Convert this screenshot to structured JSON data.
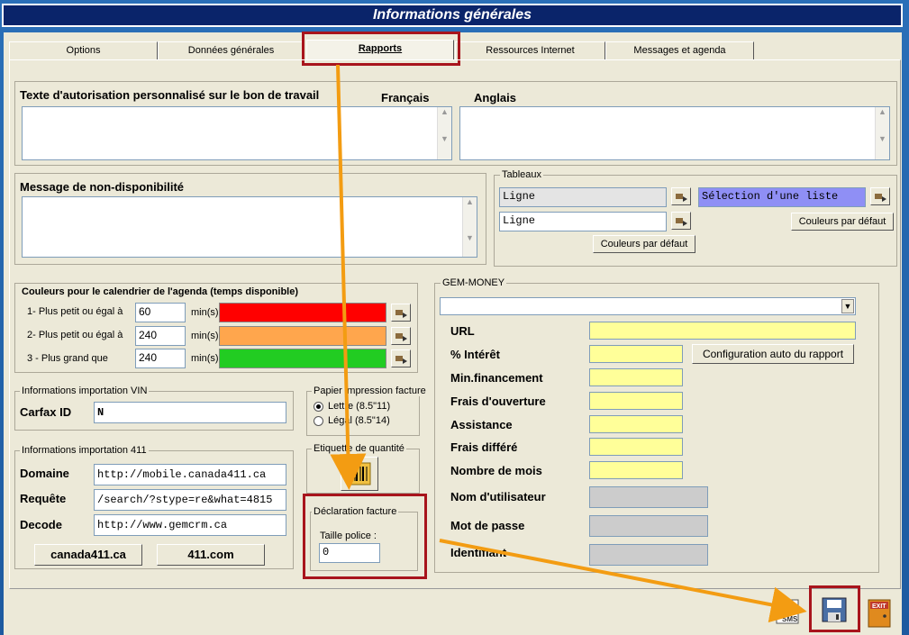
{
  "window": {
    "title": "Informations générales"
  },
  "tabs": [
    {
      "label": "Options"
    },
    {
      "label": "Données générales"
    },
    {
      "label": "Rapports"
    },
    {
      "label": "Ressources Internet"
    },
    {
      "label": "Messages et agenda"
    }
  ],
  "auth_text": {
    "title": "Texte d'autorisation personnalisé sur le bon de travail",
    "french_label": "Français",
    "english_label": "Anglais",
    "french_value": "",
    "english_value": ""
  },
  "unavailable": {
    "title": "Message de non-disponibilité",
    "value": ""
  },
  "tableaux": {
    "title": "Tableaux",
    "field1": "Ligne",
    "field2": "Ligne",
    "list_select": "Sélection d'une liste",
    "default_colors_1": "Couleurs par défaut",
    "default_colors_2": "Couleurs par défaut"
  },
  "calendar_colors": {
    "title": "Couleurs pour le calendrier de l'agenda (temps disponible)",
    "unit": "min(s)",
    "rows": [
      {
        "label": "1- Plus petit ou égal à",
        "value": "60",
        "color": "#ff0000"
      },
      {
        "label": "2- Plus petit ou égal à",
        "value": "240",
        "color": "#ffa64d"
      },
      {
        "label": "3 - Plus grand que",
        "value": "240",
        "color": "#22cc22"
      }
    ]
  },
  "vin": {
    "title": "Informations importation VIN",
    "label": "Carfax ID",
    "value": "N"
  },
  "paper": {
    "title": "Papier impression facture",
    "opt1": "Lettre (8.5\"11)",
    "opt2": "Légal (8.5\"14)"
  },
  "import411": {
    "title": "Informations importation 411",
    "domaine_label": "Domaine",
    "domaine_value": "http://mobile.canada411.ca",
    "requete_label": "Requête",
    "requete_value": "/search/?stype=re&what=4815",
    "decode_label": "Decode",
    "decode_value": "http://www.gemcrm.ca",
    "btn1": "canada411.ca",
    "btn2": "411.com"
  },
  "etiquette": {
    "title": "Etiquette de quantité"
  },
  "declaration": {
    "title": "Déclaration facture",
    "font_label": "Taille police :",
    "font_value": "0"
  },
  "gem_money": {
    "title": "GEM-MONEY",
    "dropdown_value": "",
    "url_label": "URL",
    "interet_label": "% Intérêt",
    "config_button": "Configuration auto du rapport",
    "min_label": "Min.financement",
    "frais_ouv_label": "Frais d'ouverture",
    "assistance_label": "Assistance",
    "frais_diff_label": "Frais différé",
    "nb_mois_label": "Nombre de mois",
    "user_label": "Nom d'utilisateur",
    "pass_label": "Mot de passe",
    "ident_label": "Identifiant"
  },
  "toolbar": {
    "sms_label": "SMS",
    "exit_label": "EXIT"
  },
  "colors": {
    "accent_red": "#a8141c",
    "arrow_orange": "#f39c12",
    "title_bg": "#0a246a"
  }
}
